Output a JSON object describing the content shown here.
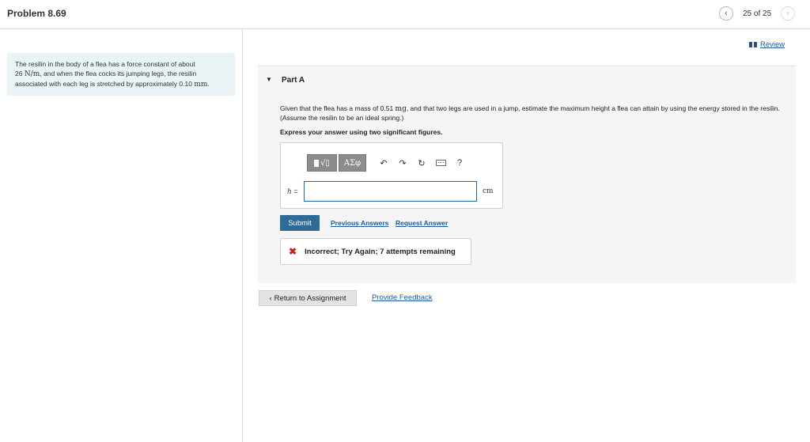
{
  "header": {
    "title": "Problem 8.69",
    "pager": "25 of 25",
    "prev_icon": "chevron-left-icon",
    "next_icon": "chevron-right-icon"
  },
  "context": {
    "line1": "The resilin in the body of a flea has a force constant of about",
    "line2_value": "26",
    "line2_unit": "N/m",
    "line2_rest": ", and when the flea cocks its jumping legs, the resilin",
    "line3_text": "associated with each leg is stretched by approximately 0.10",
    "line3_unit": "mm",
    "line3_end": "."
  },
  "review": {
    "label": "Review",
    "icon": "book-icon"
  },
  "part": {
    "caret": "▼",
    "title": "Part A",
    "question_before": "Given that the flea has a mass of 0.51 ",
    "question_unit": "mg",
    "question_after": ", and that two legs are used in a jump, estimate the maximum height a flea can attain by using the energy stored in the resilin. (Assume the resilin to be an ideal spring.)",
    "instruction": "Express your answer using two significant figures."
  },
  "toolbar": {
    "templates_label": "√▯",
    "symbols_label": "ΑΣφ",
    "undo_icon": "↶",
    "redo_icon": "↷",
    "reset_icon": "↻",
    "help_label": "?"
  },
  "answer": {
    "variable": "h",
    "equals": "=",
    "value": "",
    "unit": "cm"
  },
  "actions": {
    "submit_label": "Submit",
    "previous_answers": "Previous Answers",
    "request_answer": "Request Answer"
  },
  "feedback": {
    "icon": "✖",
    "text": "Incorrect; Try Again; 7 attempts remaining",
    "icon_color": "#c8241b"
  },
  "footer": {
    "return_label": "Return to Assignment",
    "provide_feedback": "Provide Feedback"
  }
}
